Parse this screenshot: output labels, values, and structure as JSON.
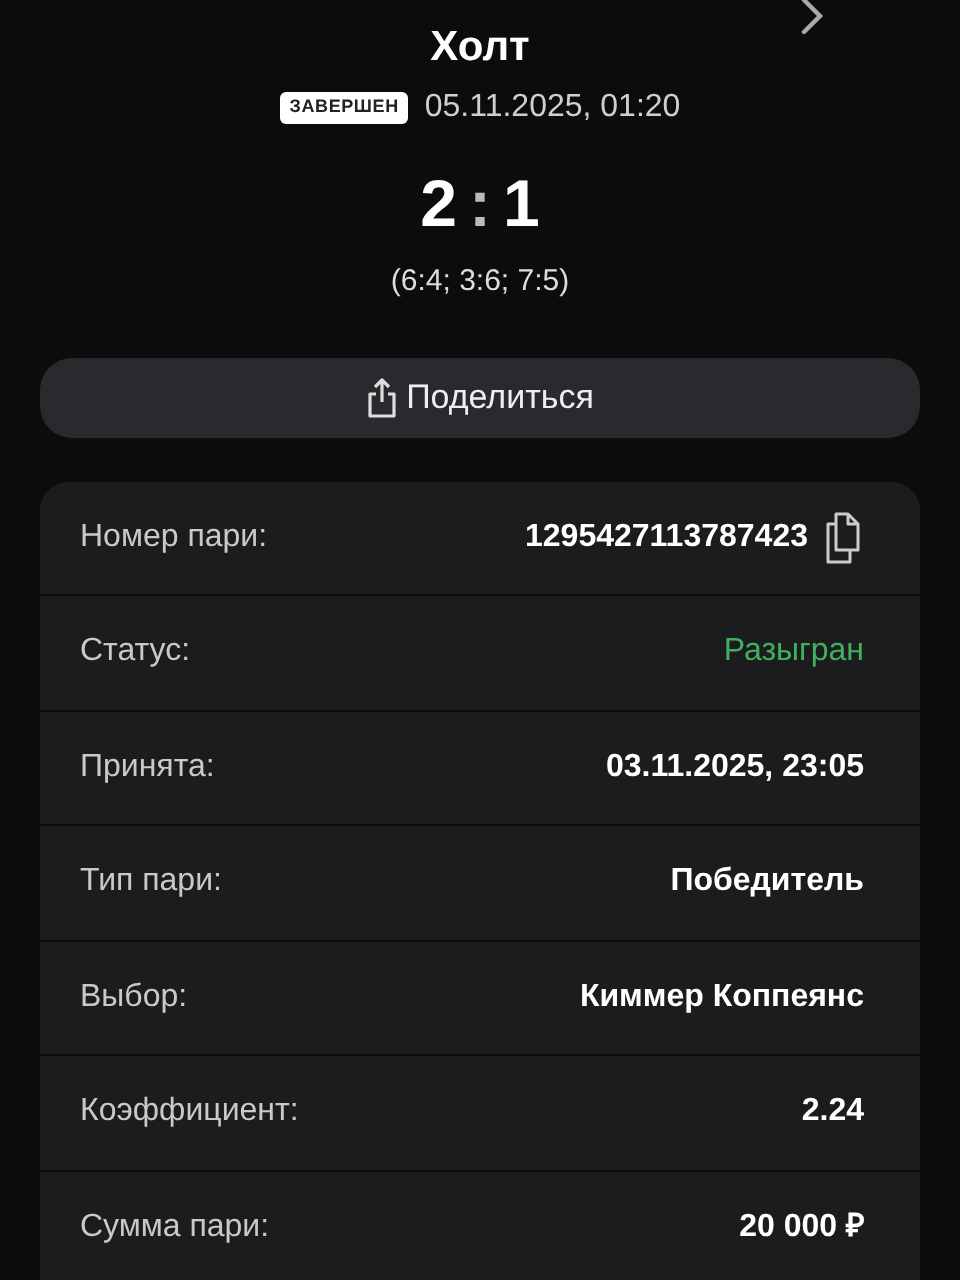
{
  "header": {
    "title": "Холт",
    "status_badge": "ЗАВЕРШЕН",
    "date": "05.11.2025, 01:20",
    "score_home": "2",
    "score_sep": ":",
    "score_away": "1",
    "sets": "(6:4; 3:6; 7:5)"
  },
  "share_button": {
    "label": "Поделиться"
  },
  "details": [
    {
      "label": "Номер пари:",
      "value": "1295427113787423",
      "kind": "copyable"
    },
    {
      "label": "Статус:",
      "value": "Разыгран",
      "kind": "status"
    },
    {
      "label": "Принята:",
      "value": "03.11.2025, 23:05",
      "kind": "plain"
    },
    {
      "label": "Тип пари:",
      "value": "Победитель",
      "kind": "plain"
    },
    {
      "label": "Выбор:",
      "value": "Киммер Коппеянс",
      "kind": "plain"
    },
    {
      "label": "Коэффициент:",
      "value": "2.24",
      "kind": "plain"
    },
    {
      "label": "Сумма пари:",
      "value": "20 000 ₽",
      "kind": "plain"
    }
  ]
}
